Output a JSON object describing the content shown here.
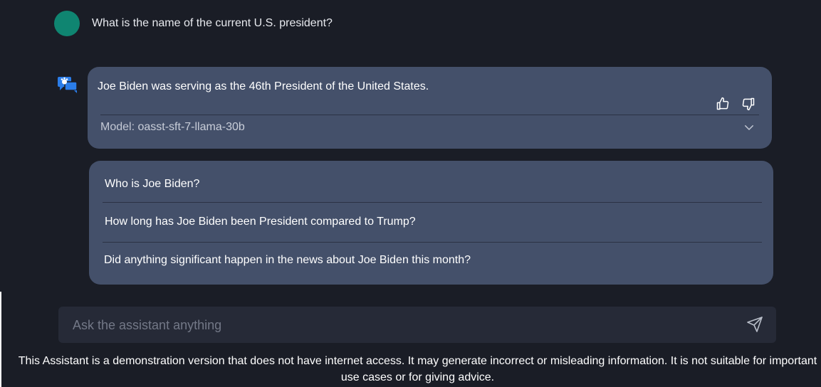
{
  "user_message": {
    "text": "What is the name of the current U.S. president?"
  },
  "answer": {
    "text": "Joe Biden was serving as the 46th President of the United States.",
    "model_label": "Model:",
    "model_name": "oasst-sft-7-llama-30b"
  },
  "icons": {
    "thumb_up": "thumbs-up-icon",
    "thumb_down": "thumbs-down-icon",
    "chevron": "chevron-down-icon",
    "send": "send-icon",
    "bot": "assistant-chat-icon"
  },
  "suggestions": [
    "Who is Joe Biden?",
    "How long has Joe Biden been President compared to Trump?",
    "Did anything significant happen in the news about Joe Biden this month?"
  ],
  "input": {
    "placeholder": "Ask the assistant anything",
    "value": ""
  },
  "disclaimer": "This Assistant is a demonstration version that does not have internet access. It may generate incorrect or misleading information. It is not suitable for important use cases or for giving advice.",
  "colors": {
    "background": "#1a1d26",
    "card": "#44506a",
    "avatar": "#0f8571",
    "bot_icon": "#2b7de9",
    "input_bg": "#262a37"
  }
}
